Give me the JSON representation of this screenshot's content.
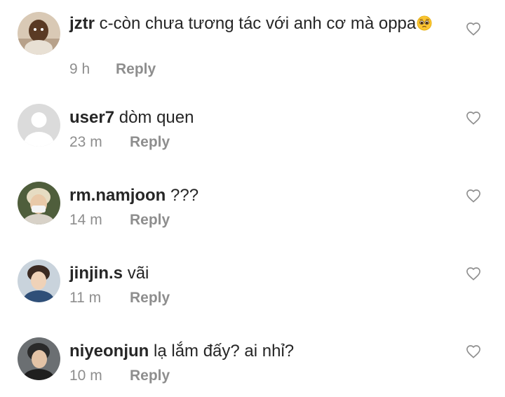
{
  "comments": [
    {
      "username": "jztr",
      "text": "c-còn chưa tương tác với anh cơ mà oppa",
      "emoji": "pleading-face-emoji",
      "time": "9 h",
      "reply_label": "Reply"
    },
    {
      "username": "user7",
      "text": "dòm quen",
      "time": "23 m",
      "reply_label": "Reply"
    },
    {
      "username": "rm.namjoon",
      "text": "???",
      "time": "14 m",
      "reply_label": "Reply"
    },
    {
      "username": "jinjin.s",
      "text": "vãi",
      "time": "11 m",
      "reply_label": "Reply"
    },
    {
      "username": "niyeonjun",
      "text": "lạ lắm đấy? ai nhỉ?",
      "time": "10 m",
      "reply_label": "Reply"
    }
  ],
  "icons": {
    "like": "heart-outline-icon",
    "default_avatar": "default-avatar-icon"
  },
  "colors": {
    "text": "#262626",
    "secondary": "#8e8e8e",
    "icon": "#8e8e8e",
    "default_avatar_bg": "#dbdbdb",
    "emoji_face": "#fbc531"
  }
}
